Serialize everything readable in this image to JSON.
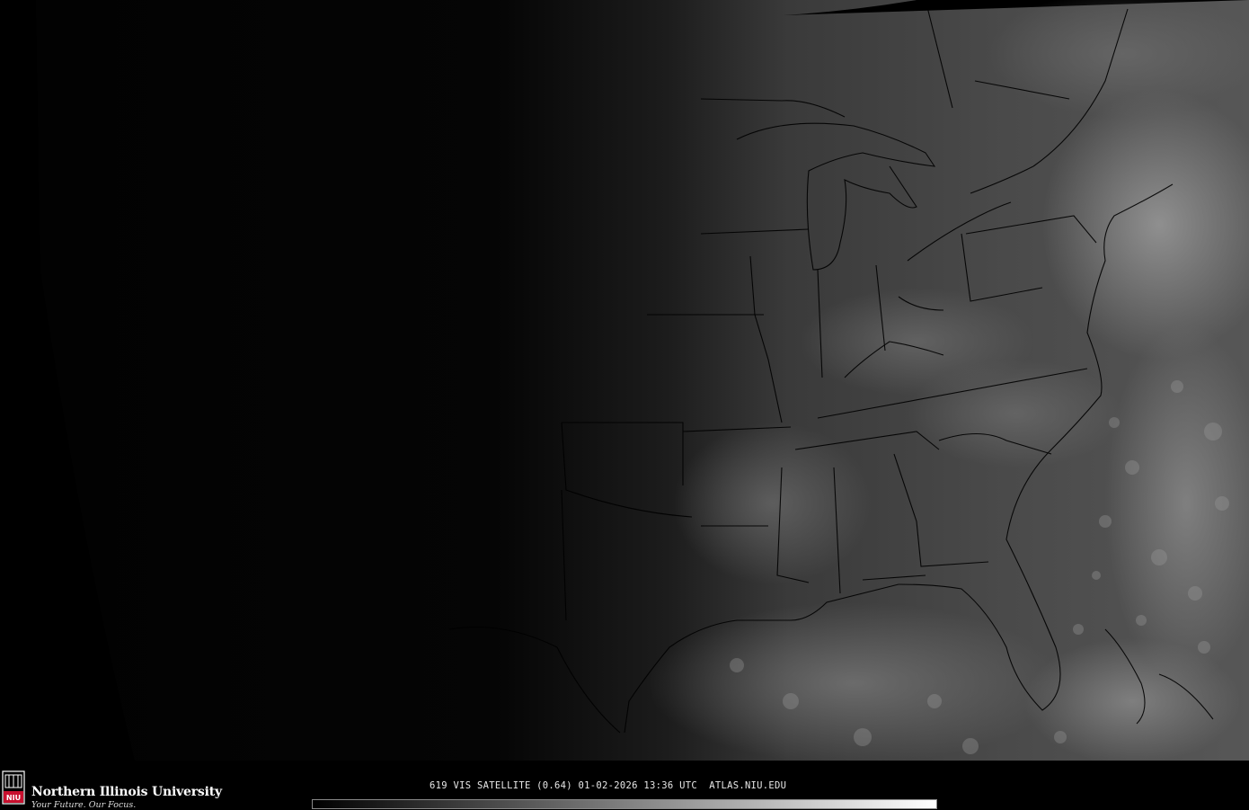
{
  "footer": {
    "logo_name": "Northern Illinois University",
    "logo_tagline": "Your Future. Our Focus.",
    "logo_mark_text": "NIU",
    "caption": "619 VIS SATELLITE (0.64) 01-02-2026 13:36 UTC  ATLAS.NIU.EDU"
  },
  "colors": {
    "background": "#000000",
    "logo_red": "#c8102e",
    "boundary_lines": "#000000",
    "colorbar_start": "#000000",
    "colorbar_end": "#ffffff"
  },
  "icons": {
    "logo": "niu-seal-icon"
  }
}
